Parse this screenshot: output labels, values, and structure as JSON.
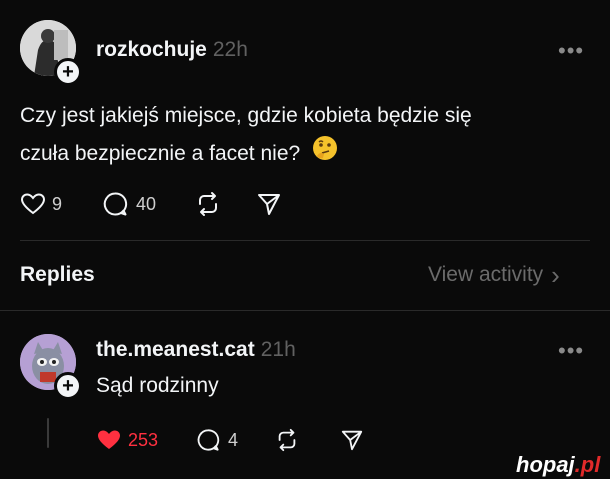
{
  "post": {
    "username": "rozkochuje",
    "time": "22h",
    "more_label": "•••",
    "text_line1": "Czy jest jakiejś miejsce, gdzie kobieta będzie się",
    "text_line2": "czuła bezpiecznie a facet nie?",
    "emoji": "🤔",
    "likes": "9",
    "comments": "40",
    "liked": false
  },
  "replies_header": {
    "title": "Replies",
    "view_activity": "View activity",
    "chevron": "›"
  },
  "reply": {
    "username": "the.meanest.cat",
    "time": "21h",
    "more_label": "•••",
    "text": "Sąd rodzinny",
    "likes": "253",
    "comments": "4",
    "liked": true
  },
  "icons": {
    "heart": "heart-icon",
    "comment": "comment-icon",
    "repost": "repost-icon",
    "share": "share-icon",
    "follow": "plus-icon"
  },
  "colors": {
    "background": "#0a0a0a",
    "text": "#f3f5f7",
    "muted": "#616161",
    "like_red": "#ff3040"
  },
  "watermark": {
    "name": "hopaj",
    "tld": ".pl"
  }
}
